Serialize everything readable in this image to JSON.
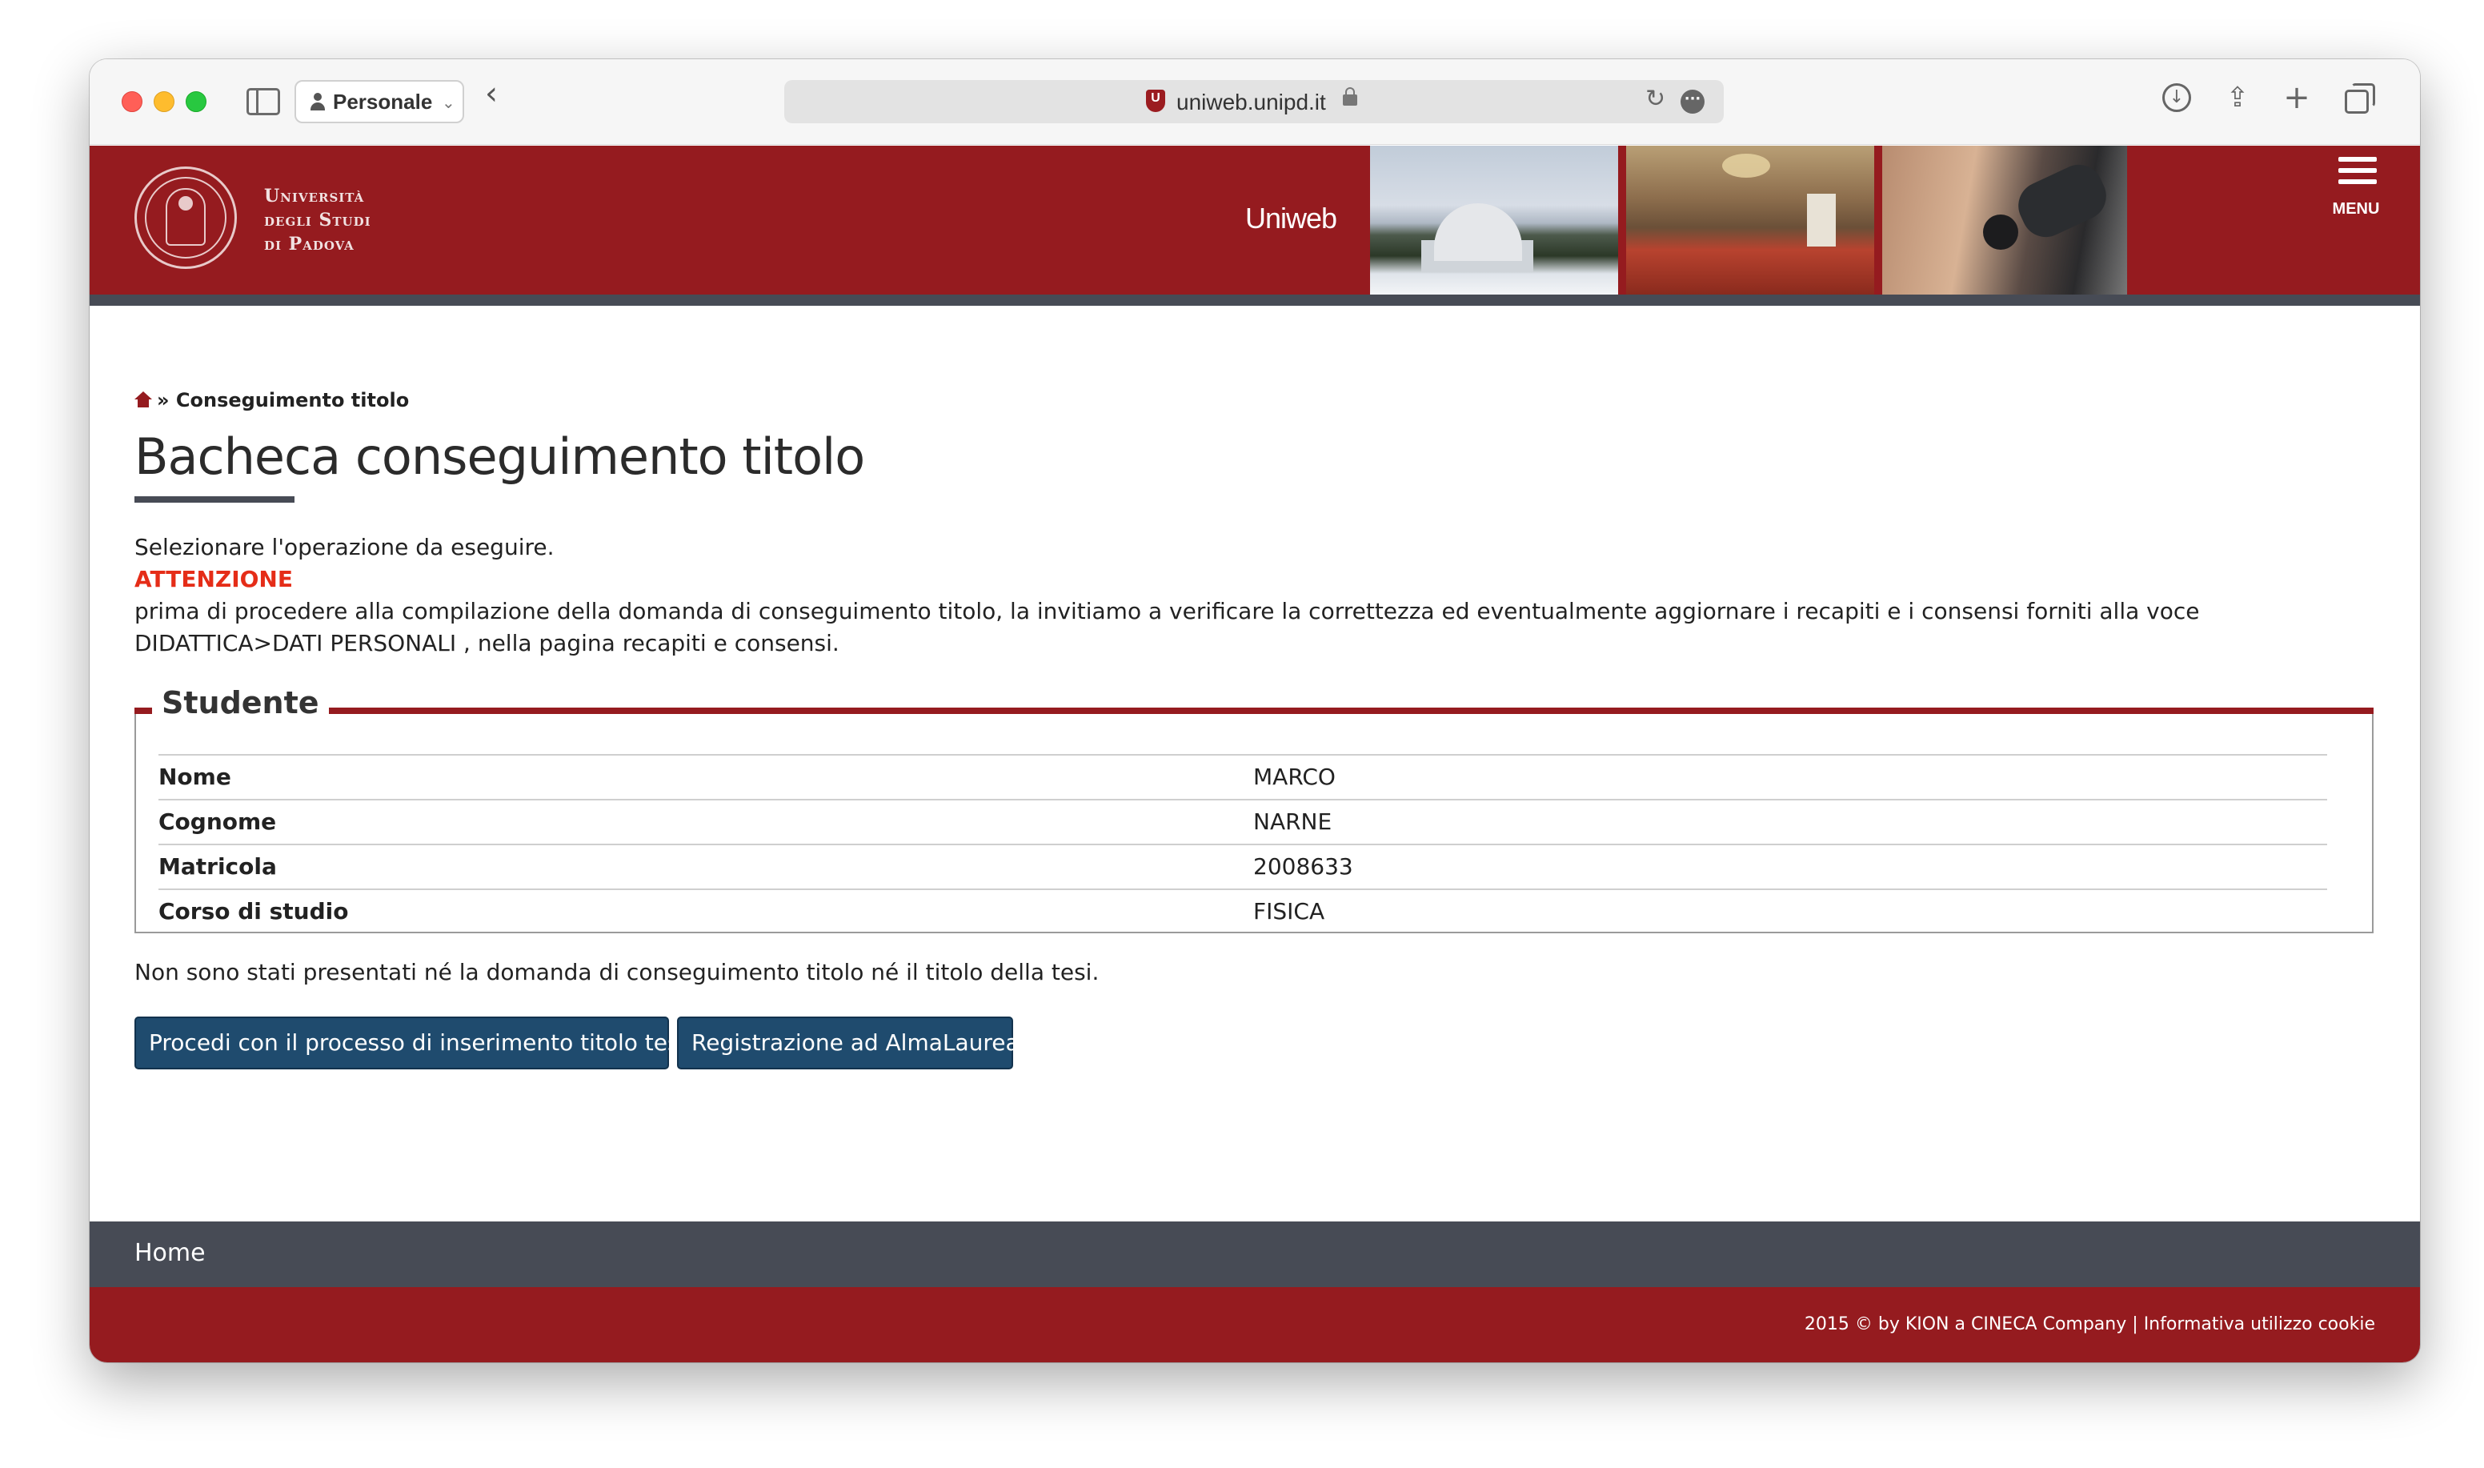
{
  "browser": {
    "profile_label": "Personale",
    "url": "uniweb.unipd.it"
  },
  "header": {
    "university_name": [
      "Università",
      "degli Studi",
      "di Padova"
    ],
    "app_title": "Uniweb",
    "menu_label": "MENU",
    "brand_color": "#951b1f",
    "accent_dark": "#474b55"
  },
  "breadcrumb": {
    "separator": "»",
    "current": "Conseguimento titolo"
  },
  "page": {
    "title": "Bacheca conseguimento titolo",
    "instruction": "Selezionare l'operazione da eseguire.",
    "warning_label": "ATTENZIONE",
    "warning_text": "prima di procedere alla compilazione della domanda di conseguimento titolo, la invitiamo a verificare la correttezza ed eventualmente aggiornare i recapiti e i consensi forniti alla voce DIDATTICA>DATI PERSONALI , nella pagina recapiti e consensi."
  },
  "student": {
    "legend": "Studente",
    "rows": [
      {
        "label": "Nome",
        "value": "MARCO"
      },
      {
        "label": "Cognome",
        "value": "NARNE"
      },
      {
        "label": "Matricola",
        "value": "2008633"
      },
      {
        "label": "Corso di studio",
        "value": "FISICA"
      }
    ]
  },
  "status_text": "Non sono stati presentati né la domanda di conseguimento titolo né il titolo della tesi.",
  "actions": {
    "primary": "Procedi con il processo di inserimento titolo tesi",
    "secondary": "Registrazione ad AlmaLaurea",
    "button_color": "#1f4b6e"
  },
  "footer": {
    "nav_home": "Home",
    "copyright": "2015 © by KION a CINECA Company",
    "separator": "|",
    "cookie_link": "Informativa utilizzo cookie"
  },
  "icons": {
    "sidebar": "sidebar-icon",
    "profile": "person-icon",
    "back": "chevron-left-icon",
    "site_badge": "shield-icon",
    "lock": "lock-icon",
    "reload": "reload-icon",
    "more": "ellipsis-icon",
    "download": "download-icon",
    "share": "share-icon",
    "new_tab": "plus-icon",
    "tab_overview": "tabs-icon",
    "home": "home-icon",
    "menu": "hamburger-icon"
  }
}
